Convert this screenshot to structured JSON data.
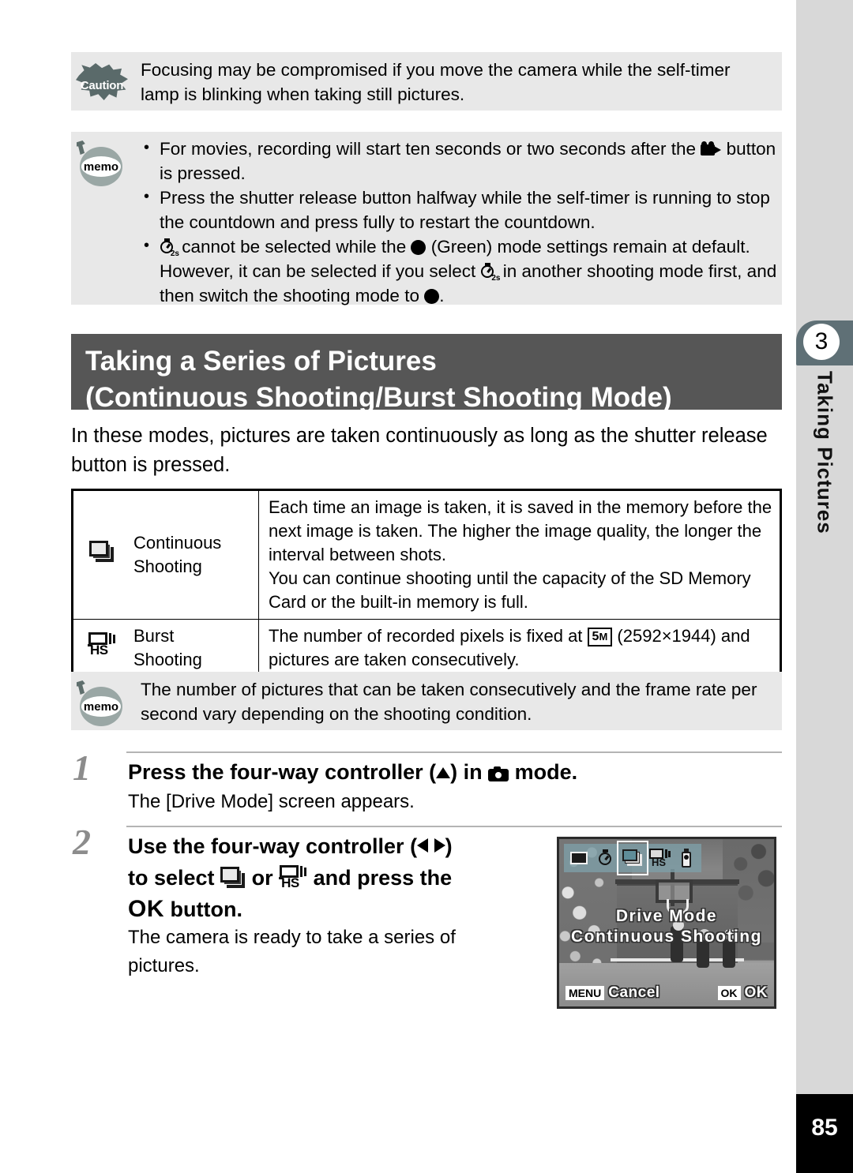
{
  "page": {
    "number": "85",
    "chapter_number": "3",
    "chapter_label": "Taking Pictures"
  },
  "caution": {
    "badge_label": "Caution",
    "text": "Focusing may be compromised if you move the camera while the self-timer lamp is blinking when taking still pictures."
  },
  "memo_top": {
    "badge_label": "memo",
    "bullets": [
      {
        "before": "For movies, recording will start ten seconds or two seconds after the",
        "icon": "movie-mode-icon",
        "after": "button is pressed."
      },
      {
        "before": "Press the shutter release button halfway while the self-timer is running to stop the countdown and press fully to restart the countdown.",
        "icon": "",
        "after": ""
      },
      {
        "part1": "",
        "icon1": "self-timer-2s-icon",
        "part2": "cannot be selected while the",
        "icon2": "green-mode-icon",
        "part3": "(Green) mode settings remain at default. However, it can be selected if you select",
        "icon3": "self-timer-2s-icon",
        "part4": "in another shooting mode first, and then switch the shooting mode to",
        "icon4": "green-mode-icon",
        "part5": "."
      }
    ]
  },
  "section": {
    "title_line1": "Taking a Series of Pictures",
    "title_line2": "(Continuous Shooting/Burst Shooting Mode)",
    "intro": "In these modes, pictures are taken continuously as long as the shutter release button is pressed."
  },
  "mode_table": {
    "rows": [
      {
        "icon": "continuous-shooting-icon",
        "name_line1": "Continuous",
        "name_line2": "Shooting",
        "desc_p1": "Each time an image is taken, it is saved in the memory before the next image is taken. The higher the image quality, the longer the interval between shots.",
        "desc_p2": "You can continue shooting until the capacity of the SD Memory Card or the built-in memory is full."
      },
      {
        "icon": "burst-shooting-hs-icon",
        "name_line1": "Burst",
        "name_line2": "Shooting",
        "desc_before": "The number of recorded pixels is fixed at",
        "pixel_badge": "5",
        "pixel_badge_unit": "M",
        "desc_after": "(2592×1944) and pictures are taken consecutively."
      }
    ]
  },
  "memo_bottom": {
    "badge_label": "memo",
    "text": "The number of pictures that can be taken consecutively and the frame rate per second vary depending on the shooting condition."
  },
  "steps": [
    {
      "number": "1",
      "head_before": "Press the four-way controller (",
      "head_arrow": "up-arrow-icon",
      "head_mid": ") in",
      "head_icon": "still-picture-mode-icon",
      "head_after": "mode.",
      "body": "The [Drive Mode] screen appears."
    },
    {
      "number": "2",
      "head_l1_before": "Use the four-way controller (",
      "head_l1_after": ")",
      "head_l2_before": "to select",
      "head_l2_icon1": "continuous-shooting-icon",
      "head_l2_mid": "or",
      "head_l2_icon2": "burst-shooting-hs-icon",
      "head_l2_after": "and press the",
      "head_l3_ok": "OK",
      "head_l3_after": "button.",
      "body": "The camera is ready to take a series of pictures."
    }
  ],
  "lcd": {
    "icons": [
      "single-frame-icon",
      "self-timer-icon",
      "continuous-shooting-icon",
      "burst-shooting-hs-icon",
      "remote-control-icon"
    ],
    "selected_icon_index": 2,
    "osd_title": "Drive Mode",
    "osd_subtitle": "Continuous Shooting",
    "menu_key": "MENU",
    "menu_label": "Cancel",
    "ok_key": "OK",
    "ok_label": "OK",
    "burst_hs_text": "HS"
  },
  "colors": {
    "banner_bg": "#565656",
    "callout_bg": "#e8e8e8",
    "rail_bg": "#d8d8d8",
    "tab_bg": "#5f7076",
    "step_num": "#8c8c8c",
    "lcd_icon_bar": "#7e9ea6"
  }
}
